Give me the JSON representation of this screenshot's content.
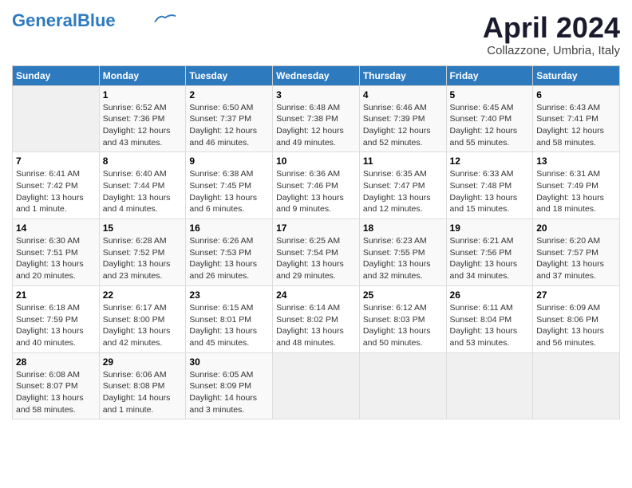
{
  "header": {
    "logo_general": "General",
    "logo_blue": "Blue",
    "month": "April 2024",
    "location": "Collazzone, Umbria, Italy"
  },
  "weekdays": [
    "Sunday",
    "Monday",
    "Tuesday",
    "Wednesday",
    "Thursday",
    "Friday",
    "Saturday"
  ],
  "weeks": [
    [
      {
        "day": "",
        "info": ""
      },
      {
        "day": "1",
        "info": "Sunrise: 6:52 AM\nSunset: 7:36 PM\nDaylight: 12 hours\nand 43 minutes."
      },
      {
        "day": "2",
        "info": "Sunrise: 6:50 AM\nSunset: 7:37 PM\nDaylight: 12 hours\nand 46 minutes."
      },
      {
        "day": "3",
        "info": "Sunrise: 6:48 AM\nSunset: 7:38 PM\nDaylight: 12 hours\nand 49 minutes."
      },
      {
        "day": "4",
        "info": "Sunrise: 6:46 AM\nSunset: 7:39 PM\nDaylight: 12 hours\nand 52 minutes."
      },
      {
        "day": "5",
        "info": "Sunrise: 6:45 AM\nSunset: 7:40 PM\nDaylight: 12 hours\nand 55 minutes."
      },
      {
        "day": "6",
        "info": "Sunrise: 6:43 AM\nSunset: 7:41 PM\nDaylight: 12 hours\nand 58 minutes."
      }
    ],
    [
      {
        "day": "7",
        "info": "Sunrise: 6:41 AM\nSunset: 7:42 PM\nDaylight: 13 hours\nand 1 minute."
      },
      {
        "day": "8",
        "info": "Sunrise: 6:40 AM\nSunset: 7:44 PM\nDaylight: 13 hours\nand 4 minutes."
      },
      {
        "day": "9",
        "info": "Sunrise: 6:38 AM\nSunset: 7:45 PM\nDaylight: 13 hours\nand 6 minutes."
      },
      {
        "day": "10",
        "info": "Sunrise: 6:36 AM\nSunset: 7:46 PM\nDaylight: 13 hours\nand 9 minutes."
      },
      {
        "day": "11",
        "info": "Sunrise: 6:35 AM\nSunset: 7:47 PM\nDaylight: 13 hours\nand 12 minutes."
      },
      {
        "day": "12",
        "info": "Sunrise: 6:33 AM\nSunset: 7:48 PM\nDaylight: 13 hours\nand 15 minutes."
      },
      {
        "day": "13",
        "info": "Sunrise: 6:31 AM\nSunset: 7:49 PM\nDaylight: 13 hours\nand 18 minutes."
      }
    ],
    [
      {
        "day": "14",
        "info": "Sunrise: 6:30 AM\nSunset: 7:51 PM\nDaylight: 13 hours\nand 20 minutes."
      },
      {
        "day": "15",
        "info": "Sunrise: 6:28 AM\nSunset: 7:52 PM\nDaylight: 13 hours\nand 23 minutes."
      },
      {
        "day": "16",
        "info": "Sunrise: 6:26 AM\nSunset: 7:53 PM\nDaylight: 13 hours\nand 26 minutes."
      },
      {
        "day": "17",
        "info": "Sunrise: 6:25 AM\nSunset: 7:54 PM\nDaylight: 13 hours\nand 29 minutes."
      },
      {
        "day": "18",
        "info": "Sunrise: 6:23 AM\nSunset: 7:55 PM\nDaylight: 13 hours\nand 32 minutes."
      },
      {
        "day": "19",
        "info": "Sunrise: 6:21 AM\nSunset: 7:56 PM\nDaylight: 13 hours\nand 34 minutes."
      },
      {
        "day": "20",
        "info": "Sunrise: 6:20 AM\nSunset: 7:57 PM\nDaylight: 13 hours\nand 37 minutes."
      }
    ],
    [
      {
        "day": "21",
        "info": "Sunrise: 6:18 AM\nSunset: 7:59 PM\nDaylight: 13 hours\nand 40 minutes."
      },
      {
        "day": "22",
        "info": "Sunrise: 6:17 AM\nSunset: 8:00 PM\nDaylight: 13 hours\nand 42 minutes."
      },
      {
        "day": "23",
        "info": "Sunrise: 6:15 AM\nSunset: 8:01 PM\nDaylight: 13 hours\nand 45 minutes."
      },
      {
        "day": "24",
        "info": "Sunrise: 6:14 AM\nSunset: 8:02 PM\nDaylight: 13 hours\nand 48 minutes."
      },
      {
        "day": "25",
        "info": "Sunrise: 6:12 AM\nSunset: 8:03 PM\nDaylight: 13 hours\nand 50 minutes."
      },
      {
        "day": "26",
        "info": "Sunrise: 6:11 AM\nSunset: 8:04 PM\nDaylight: 13 hours\nand 53 minutes."
      },
      {
        "day": "27",
        "info": "Sunrise: 6:09 AM\nSunset: 8:06 PM\nDaylight: 13 hours\nand 56 minutes."
      }
    ],
    [
      {
        "day": "28",
        "info": "Sunrise: 6:08 AM\nSunset: 8:07 PM\nDaylight: 13 hours\nand 58 minutes."
      },
      {
        "day": "29",
        "info": "Sunrise: 6:06 AM\nSunset: 8:08 PM\nDaylight: 14 hours\nand 1 minute."
      },
      {
        "day": "30",
        "info": "Sunrise: 6:05 AM\nSunset: 8:09 PM\nDaylight: 14 hours\nand 3 minutes."
      },
      {
        "day": "",
        "info": ""
      },
      {
        "day": "",
        "info": ""
      },
      {
        "day": "",
        "info": ""
      },
      {
        "day": "",
        "info": ""
      }
    ]
  ]
}
